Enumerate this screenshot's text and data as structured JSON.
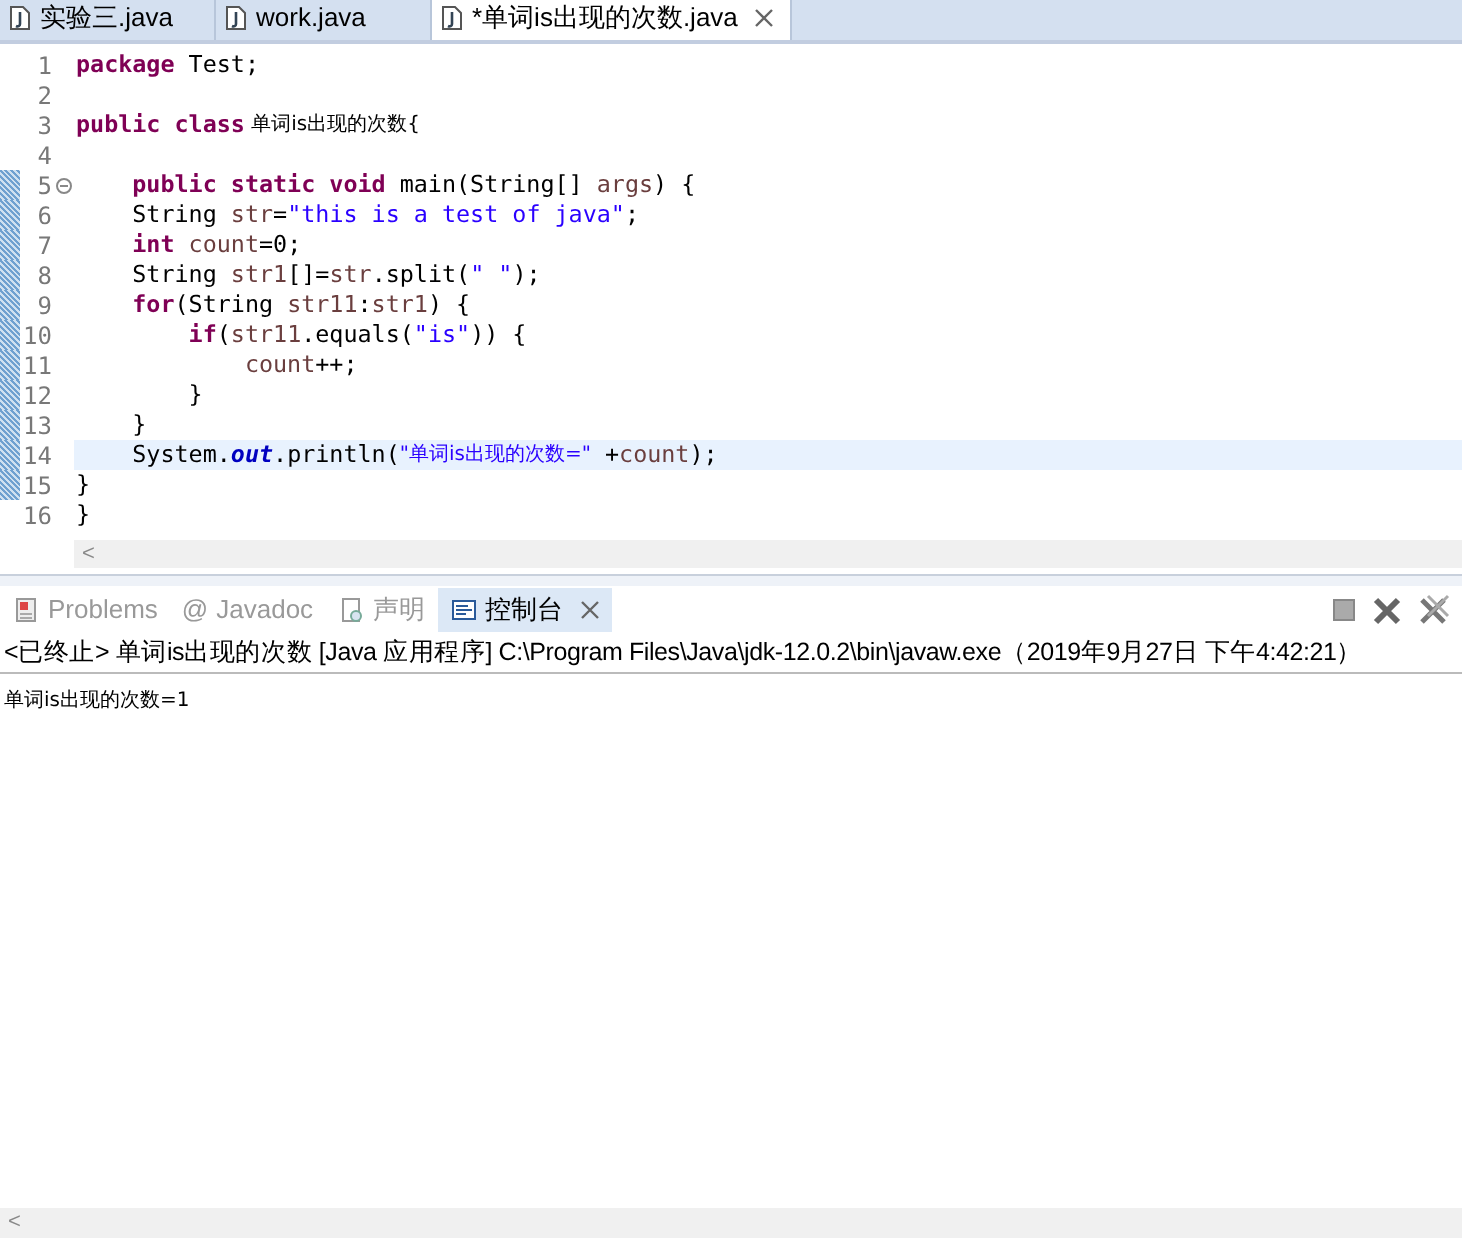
{
  "editor_tabs": [
    {
      "label": "实验三.java",
      "selected": false,
      "closable": false
    },
    {
      "label": "work.java",
      "selected": false,
      "closable": false
    },
    {
      "label": "*单词is出现的次数.java",
      "selected": true,
      "closable": true
    }
  ],
  "code_lines": [
    {
      "number": "1",
      "changed": false,
      "foldable": false,
      "current": false,
      "segments": [
        {
          "kind": "keyword",
          "text": "package"
        },
        {
          "kind": "plain",
          "text": " Test;"
        }
      ]
    },
    {
      "number": "2",
      "changed": false,
      "foldable": false,
      "current": false
    },
    {
      "number": "3",
      "changed": false,
      "foldable": false,
      "current": false,
      "segments": [
        {
          "kind": "keyword",
          "text": "public class"
        },
        {
          "kind": "cjk",
          "text": " 单词is出现的次数{"
        }
      ]
    },
    {
      "number": "4",
      "changed": false,
      "foldable": false,
      "current": false
    },
    {
      "number": "5",
      "changed": true,
      "foldable": true,
      "current": false,
      "segments": [
        {
          "kind": "keyword",
          "text": "    public static void"
        },
        {
          "kind": "plain",
          "text": " main(String[] "
        },
        {
          "kind": "param",
          "text": "args"
        },
        {
          "kind": "plain",
          "text": ") {"
        }
      ]
    },
    {
      "number": "6",
      "changed": true,
      "foldable": false,
      "current": false,
      "segments": [
        {
          "kind": "plain",
          "text": "    String "
        },
        {
          "kind": "param",
          "text": "str"
        },
        {
          "kind": "plain",
          "text": "="
        },
        {
          "kind": "string",
          "text": "\"this is a test of java\""
        },
        {
          "kind": "plain",
          "text": ";"
        }
      ]
    },
    {
      "number": "7",
      "changed": true,
      "foldable": false,
      "current": false,
      "segments": [
        {
          "kind": "keyword",
          "text": "    int"
        },
        {
          "kind": "param",
          "text": " count"
        },
        {
          "kind": "plain",
          "text": "=0;"
        }
      ]
    },
    {
      "number": "8",
      "changed": true,
      "foldable": false,
      "current": false,
      "segments": [
        {
          "kind": "plain",
          "text": "    String "
        },
        {
          "kind": "param",
          "text": "str1"
        },
        {
          "kind": "plain",
          "text": "[]="
        },
        {
          "kind": "param",
          "text": "str"
        },
        {
          "kind": "plain",
          "text": ".split("
        },
        {
          "kind": "string",
          "text": "\" \""
        },
        {
          "kind": "plain",
          "text": ");"
        }
      ]
    },
    {
      "number": "9",
      "changed": true,
      "foldable": false,
      "current": false,
      "segments": [
        {
          "kind": "keyword",
          "text": "    for"
        },
        {
          "kind": "plain",
          "text": "(String "
        },
        {
          "kind": "param",
          "text": "str11"
        },
        {
          "kind": "plain",
          "text": ":"
        },
        {
          "kind": "param",
          "text": "str1"
        },
        {
          "kind": "plain",
          "text": ") {"
        }
      ]
    },
    {
      "number": "10",
      "changed": true,
      "foldable": false,
      "current": false,
      "segments": [
        {
          "kind": "keyword",
          "text": "        if"
        },
        {
          "kind": "plain",
          "text": "("
        },
        {
          "kind": "param",
          "text": "str11"
        },
        {
          "kind": "plain",
          "text": ".equals("
        },
        {
          "kind": "string",
          "text": "\"is\""
        },
        {
          "kind": "plain",
          "text": ")) {"
        }
      ]
    },
    {
      "number": "11",
      "changed": true,
      "foldable": false,
      "current": false,
      "segments": [
        {
          "kind": "param",
          "text": "            count"
        },
        {
          "kind": "plain",
          "text": "++;"
        }
      ]
    },
    {
      "number": "12",
      "changed": true,
      "foldable": false,
      "current": false,
      "segments": [
        {
          "kind": "plain",
          "text": "        }"
        }
      ]
    },
    {
      "number": "13",
      "changed": true,
      "foldable": false,
      "current": false,
      "segments": [
        {
          "kind": "plain",
          "text": "    }"
        }
      ]
    },
    {
      "number": "14",
      "changed": true,
      "foldable": false,
      "current": true,
      "segments": [
        {
          "kind": "plain",
          "text": "    System."
        },
        {
          "kind": "field",
          "text": "out"
        },
        {
          "kind": "plain",
          "text": ".println("
        },
        {
          "kind": "cjkstring",
          "text": "\"单词is出现的次数=\""
        },
        {
          "kind": "plain",
          "text": " +"
        },
        {
          "kind": "param",
          "text": "count"
        },
        {
          "kind": "plain",
          "text": ");"
        }
      ]
    },
    {
      "number": "15",
      "changed": true,
      "foldable": false,
      "current": false,
      "segments": [
        {
          "kind": "plain",
          "text": "}"
        }
      ]
    },
    {
      "number": "16",
      "changed": false,
      "foldable": false,
      "current": false,
      "segments": [
        {
          "kind": "plain",
          "text": "}"
        }
      ]
    }
  ],
  "editor_scroll": {
    "arrow": "<"
  },
  "view_tabs": [
    {
      "label": "Problems",
      "kind": "problems",
      "selected": false,
      "closable": false
    },
    {
      "label": "Javadoc",
      "kind": "glyph",
      "glyph": "@",
      "selected": false,
      "closable": false
    },
    {
      "label": "声明",
      "kind": "declaration",
      "selected": false,
      "closable": false
    },
    {
      "label": "控制台",
      "kind": "console",
      "selected": true,
      "closable": true
    }
  ],
  "console": {
    "header": "<已终止> 单词is出现的次数 [Java 应用程序] C:\\Program Files\\Java\\jdk-12.0.2\\bin\\javaw.exe（2019年9月27日 下午4:42:21）",
    "output": "单词is出现的次数=1"
  },
  "console_scroll": {
    "arrow": "<"
  }
}
